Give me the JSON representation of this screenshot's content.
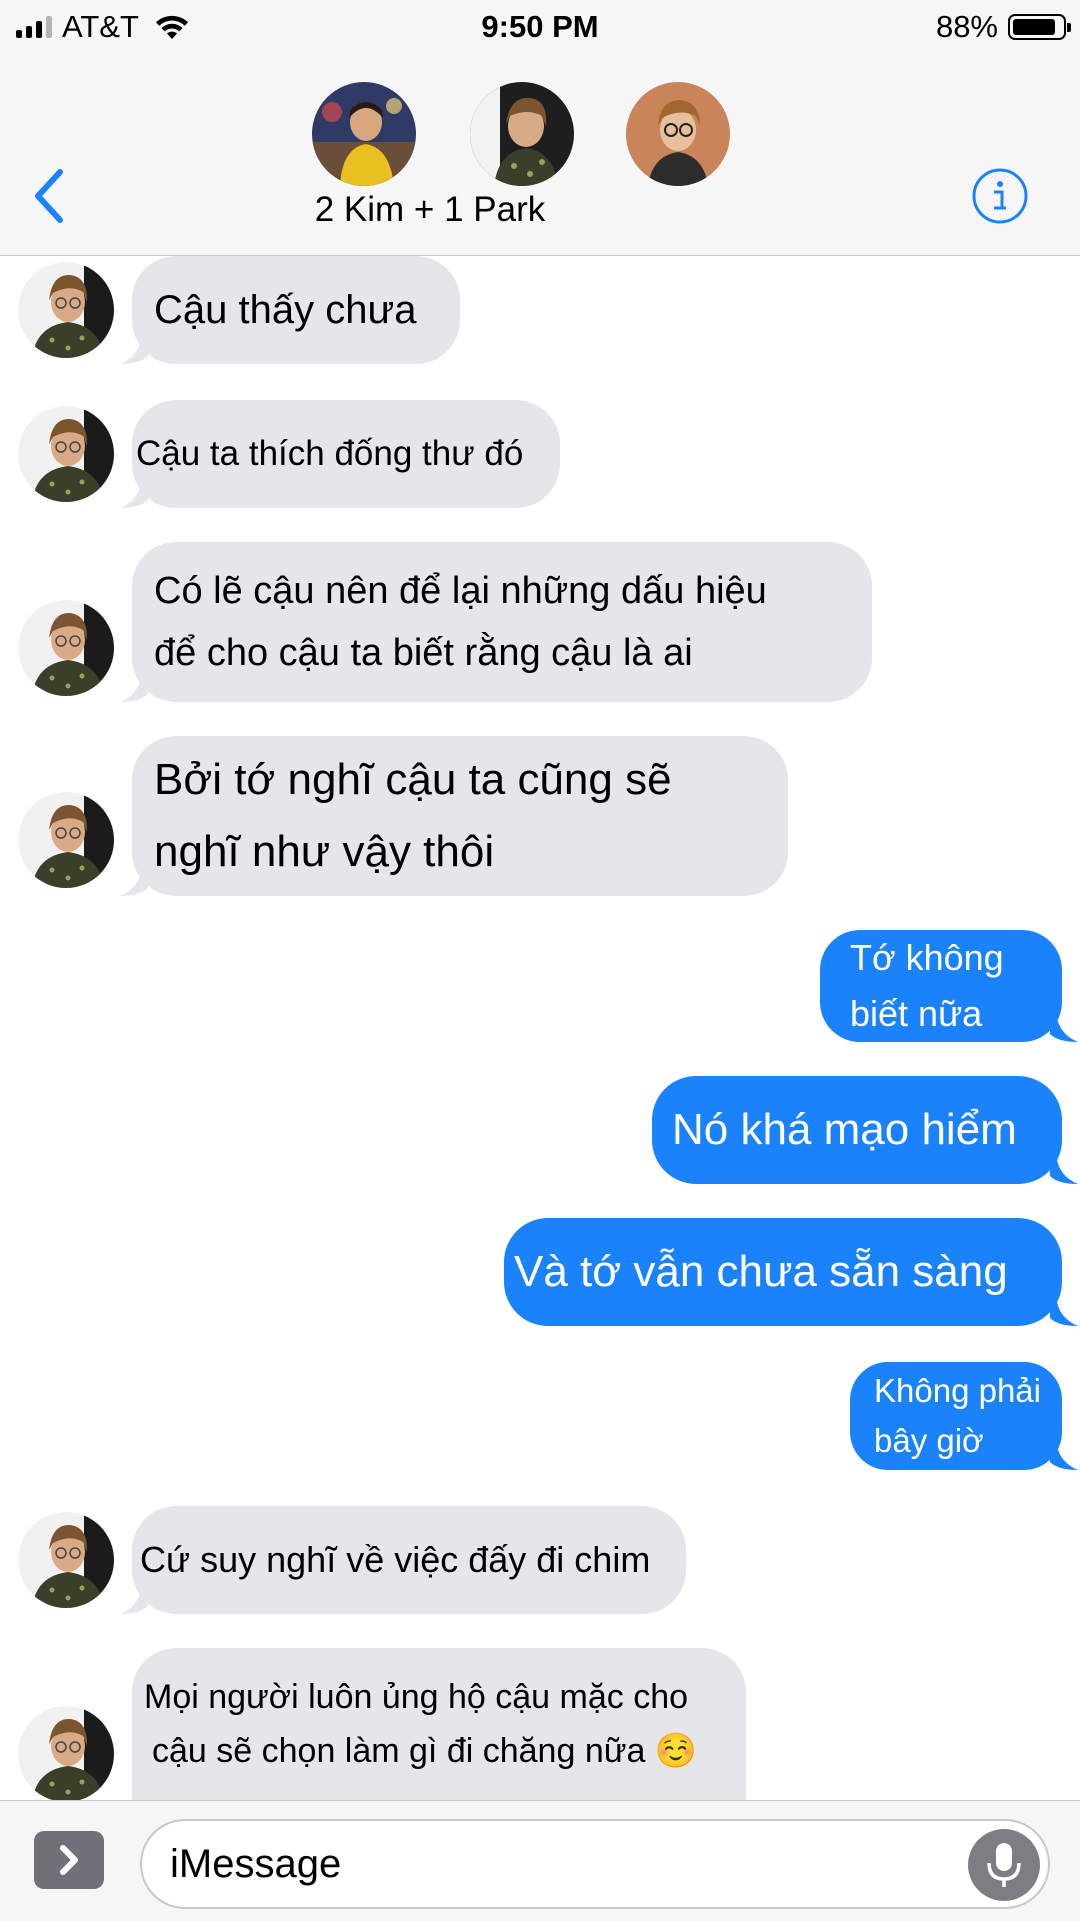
{
  "status_bar": {
    "carrier": "AT&T",
    "time": "9:50 PM",
    "battery_percent": "88%",
    "battery_level": 0.88,
    "signal_bars": 4,
    "signal_active_bars": 3
  },
  "header": {
    "group_name": "2 Kim + 1 Park",
    "participants": [
      {
        "name": "participant-1",
        "shirt_color": "#e8c020"
      },
      {
        "name": "participant-2",
        "shirt_color": "#3b3f2a"
      },
      {
        "name": "participant-3",
        "shirt_color": "#2c2c2c"
      }
    ],
    "back_icon": "chevron-left-icon",
    "info_icon": "info-icon",
    "accent_color": "#1a82fb"
  },
  "messages": [
    {
      "direction": "incoming",
      "lines": [
        "Cậu thấy chưa"
      ]
    },
    {
      "direction": "incoming",
      "lines": [
        "Cậu ta thích đống thư đó"
      ]
    },
    {
      "direction": "incoming",
      "lines": [
        "Có lẽ cậu nên để lại những dấu hiệu",
        "để cho cậu ta biết rằng cậu là ai"
      ]
    },
    {
      "direction": "incoming",
      "lines": [
        "Bởi tớ nghĩ cậu ta cũng sẽ",
        "nghĩ như vậy thôi"
      ]
    },
    {
      "direction": "outgoing",
      "lines": [
        "Tớ không",
        "biết nữa"
      ]
    },
    {
      "direction": "outgoing",
      "lines": [
        "Nó khá mạo hiểm"
      ]
    },
    {
      "direction": "outgoing",
      "lines": [
        "Và tớ vẫn chưa sẵn sàng"
      ]
    },
    {
      "direction": "outgoing",
      "lines": [
        "Không phải",
        "bây giờ"
      ]
    },
    {
      "direction": "incoming",
      "lines": [
        "Cứ suy nghĩ về việc đấy đi chim"
      ]
    },
    {
      "direction": "incoming",
      "lines": [
        "Mọi người luôn ủng hộ cậu mặc cho",
        "cậu sẽ chọn làm gì đi chăng nữa ☺️"
      ]
    }
  ],
  "input_bar": {
    "placeholder": "iMessage",
    "apps_icon": "chevron-right-icon",
    "mic_icon": "microphone-icon"
  },
  "colors": {
    "incoming_bubble": "#e5e5ea",
    "outgoing_bubble": "#1a82fb",
    "bar_background": "#f6f6f6"
  }
}
